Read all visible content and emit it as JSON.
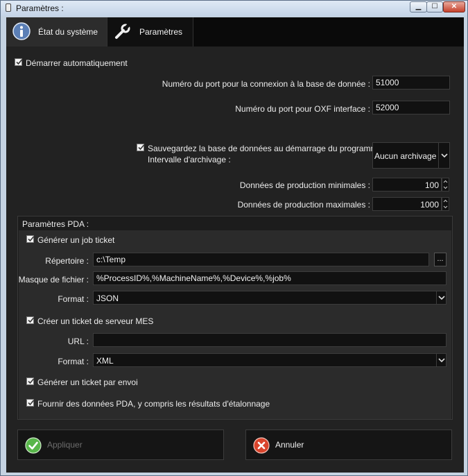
{
  "window": {
    "title": "Paramètres :"
  },
  "tabs": [
    {
      "label": "État du système",
      "icon": "info-icon"
    },
    {
      "label": "Paramètres",
      "icon": "wrench-icon"
    }
  ],
  "main": {
    "autostart_label": "Démarrer automatiquement",
    "autostart_checked": true,
    "db_port_label": "Numéro du port pour la connexion à la base de donnée :",
    "db_port_value": "51000",
    "oxf_port_label": "Numéro du port pour OXF interface :",
    "oxf_port_value": "52000",
    "save_db_label_line1": "Sauvegardez la base de données au démarrage du programme.",
    "save_db_label_line2": "Intervalle d'archivage :",
    "save_db_checked": true,
    "archive_interval_value": "Aucun archivage",
    "min_prod_label": "Données de production minimales :",
    "min_prod_value": "100",
    "max_prod_label": "Données de production maximales :",
    "max_prod_value": "1000"
  },
  "pda": {
    "title": "Paramètres PDA :",
    "job_ticket_label": "Générer un job ticket",
    "job_ticket_checked": true,
    "directory_label": "Répertoire :",
    "directory_value": "c:\\Temp",
    "browse_label": "...",
    "mask_label": "Masque de fichier :",
    "mask_value": "%ProcessID%,%MachineName%,%Device%,%job%",
    "format1_label": "Format :",
    "format1_value": "JSON",
    "mes_label": "Créer un ticket de serveur MES",
    "mes_checked": true,
    "url_label": "URL :",
    "url_value": "",
    "format2_label": "Format :",
    "format2_value": "XML",
    "per_send_label": "Générer un ticket par envoi",
    "per_send_checked": true,
    "calib_label": "Fournir des données PDA, y compris les résultats d'étalonnage",
    "calib_checked": true
  },
  "footer": {
    "apply_label": "Appliquer",
    "cancel_label": "Annuler"
  },
  "colors": {
    "apply_icon": "#58b64a",
    "cancel_icon": "#d9442c",
    "info_icon": "#5b7fb6"
  }
}
